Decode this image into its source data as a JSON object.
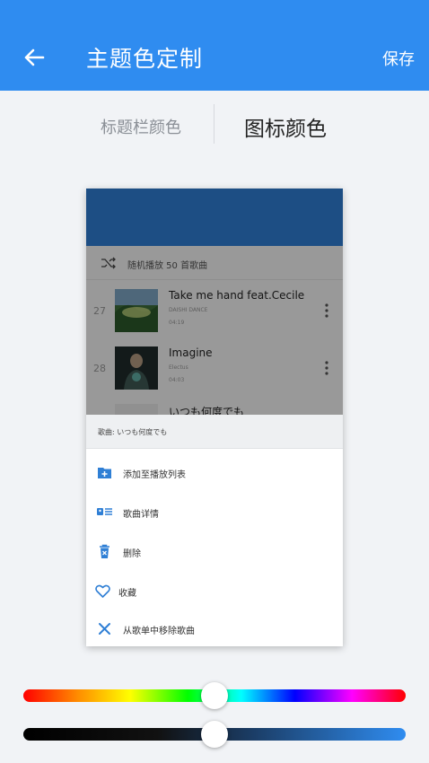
{
  "appbar": {
    "title": "主题色定制",
    "save_label": "保存",
    "color": "#2f8cf0"
  },
  "tabs": {
    "title_bar_color": "标题栏颜色",
    "icon_color": "图标颜色",
    "selected": "图标颜色"
  },
  "preview": {
    "toolbar_color": "#2f7fd5",
    "shuffle_label": "随机播放 50 首歌曲",
    "songs": [
      {
        "number": "27",
        "title": "Take me hand feat.Cecile",
        "artist": "DAISHI DANCE",
        "duration": "04:19"
      },
      {
        "number": "28",
        "title": "Imagine",
        "artist": "Electus",
        "duration": "04:03"
      },
      {
        "number": "",
        "title": "いつも何度でも",
        "artist": "",
        "duration": ""
      }
    ],
    "sheet": {
      "header": "歌曲: いつも何度でも",
      "items": [
        {
          "label": "添加至播放列表",
          "icon": "folder-add-icon"
        },
        {
          "label": "歌曲详情",
          "icon": "details-icon"
        },
        {
          "label": "删除",
          "icon": "trash-icon"
        },
        {
          "label": "收藏",
          "icon": "heart-icon"
        },
        {
          "label": "从歌单中移除歌曲",
          "icon": "close-icon"
        }
      ],
      "icon_color": "#2f7fd5"
    }
  },
  "sliders": {
    "hue_value": 0.5,
    "shade_value": 0.5
  }
}
